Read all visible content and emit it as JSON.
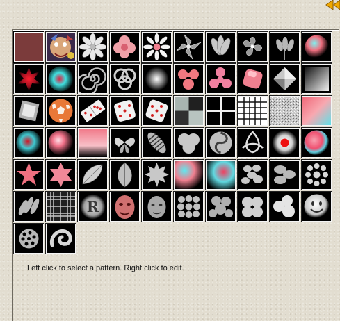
{
  "help_text": "Left click to select a pattern. Right click to edit.",
  "colors": {
    "background": "#e2ddd0",
    "accent_arrow": "#f0a800",
    "tile_border": "#f4f4f4",
    "tile_background": "#000000"
  },
  "icons": {
    "nav_arrows": "double-left-arrow-icon"
  },
  "patterns": [
    "solid-brown",
    "photo-collage",
    "white-flower",
    "pink-flower",
    "daisy",
    "lily",
    "petals",
    "hibiscus",
    "tulips",
    "cyan-pink-sphere",
    "red-burst",
    "cyan-red-glow",
    "metal-spiral",
    "celtic-knot",
    "white-glow",
    "pink-knot",
    "pink-trefoil",
    "pink-cube",
    "white-diamond",
    "gray-gradient",
    "beveled-square",
    "soccer-ball",
    "domino",
    "white-dice",
    "white-dice-2",
    "gray-checker",
    "black-cross",
    "white-grid",
    "noise-texture",
    "pink-cyan-blur",
    "red-cyan-orb",
    "pink-glow-orb",
    "pink-blend",
    "butterfly",
    "striped-feather",
    "soft-blobs",
    "swirl-disk",
    "trefoil-knot",
    "red-dot-glow",
    "pink-cyan-sphere",
    "pink-star",
    "pink-hexstar",
    "leaves",
    "single-leaf",
    "maple-leaf",
    "cyan-pink-cloud",
    "cyan-red-cloud",
    "pebbles",
    "bubbles",
    "white-flowerburst",
    "twisted-shapes",
    "plaid",
    "letter-r",
    "face-mask",
    "face-portrait",
    "pebble-cluster",
    "stone-pile",
    "cotton-balls",
    "round-clusters",
    "smiley",
    "gear-cluster",
    "ribbon-blob"
  ],
  "selected_index": 0,
  "letter_tile_text": "R"
}
